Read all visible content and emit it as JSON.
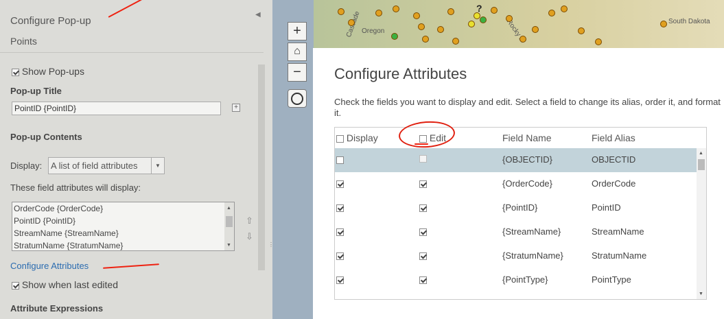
{
  "left_panel": {
    "title": "Configure Pop-up",
    "layer_name": "Points",
    "show_popups_label": "Show Pop-ups",
    "popup_title_heading": "Pop-up Title",
    "popup_title_value": "PointID {PointID}",
    "popup_contents_heading": "Pop-up Contents",
    "display_label": "Display:",
    "display_value": "A list of field attributes",
    "field_list_caption": "These field attributes will display:",
    "field_list": [
      "OrderCode {OrderCode}",
      "PointID {PointID}",
      "StreamName {StreamName}",
      "StratumName {StratumName}"
    ],
    "configure_attributes_link": "Configure Attributes",
    "show_last_edited_label": "Show when last edited",
    "attribute_expressions_heading": "Attribute Expressions"
  },
  "map": {
    "labels": [
      "Oregon",
      "South Dakota",
      "Cascade",
      "Rocky M"
    ],
    "marker_label": "?",
    "zoom_in": "+",
    "zoom_out": "−"
  },
  "dialog": {
    "title": "Configure Attributes",
    "instructions": "Check the fields you want to display and edit. Select a field to change its alias, order it, and format it.",
    "columns": {
      "display": "Display",
      "edit": "Edit",
      "field_name": "Field Name",
      "field_alias": "Field Alias"
    },
    "rows": [
      {
        "display": false,
        "edit": false,
        "edit_disabled": true,
        "field_name": "{OBJECTID}",
        "alias": "OBJECTID",
        "selected": true
      },
      {
        "display": true,
        "edit": true,
        "field_name": "{OrderCode}",
        "alias": "OrderCode"
      },
      {
        "display": true,
        "edit": true,
        "field_name": "{PointID}",
        "alias": "PointID"
      },
      {
        "display": true,
        "edit": true,
        "field_name": "{StreamName}",
        "alias": "StreamName"
      },
      {
        "display": true,
        "edit": true,
        "field_name": "{StratumName}",
        "alias": "StratumName"
      },
      {
        "display": true,
        "edit": true,
        "field_name": "{PointType}",
        "alias": "PointType"
      }
    ]
  },
  "colors": {
    "link": "#2b6cb0",
    "annotation": "#e02010",
    "selected_row": "#c2d3da"
  }
}
